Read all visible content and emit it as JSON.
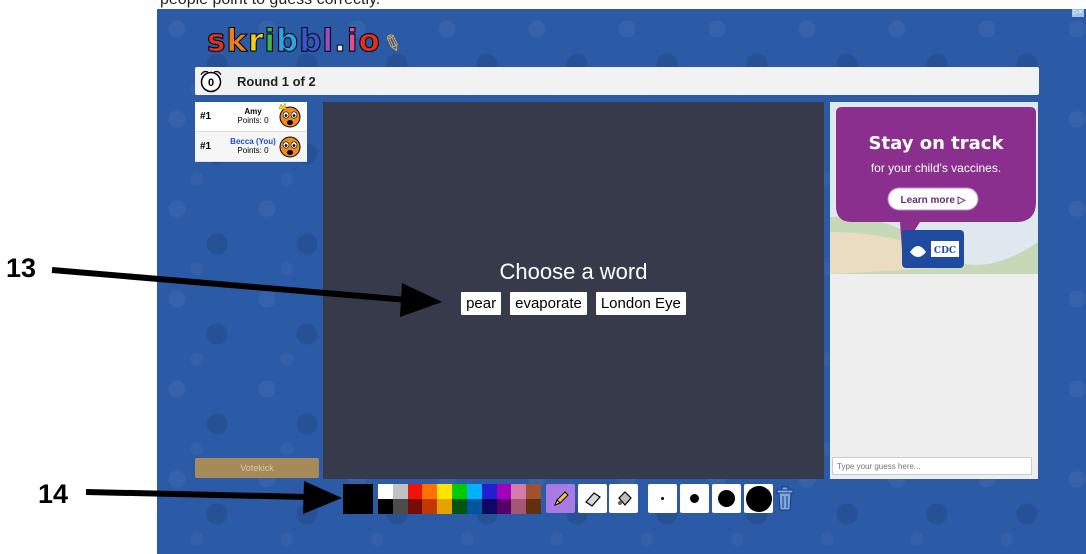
{
  "page_top_text": "people point to guess correctly.",
  "ad_tag": "▷×",
  "logo": {
    "letters": [
      {
        "ch": "s",
        "color": "#e0301e"
      },
      {
        "ch": "k",
        "color": "#f07c1a"
      },
      {
        "ch": "r",
        "color": "#f5d01a"
      },
      {
        "ch": "i",
        "color": "#42b24a"
      },
      {
        "ch": "b",
        "color": "#2fa3e0"
      },
      {
        "ch": "b",
        "color": "#3b54c8"
      },
      {
        "ch": "l",
        "color": "#9a4ec4"
      },
      {
        "ch": ".",
        "color": "#e8e8e8"
      },
      {
        "ch": "i",
        "color": "#e64c8c"
      },
      {
        "ch": "o",
        "color": "#e0301e"
      }
    ]
  },
  "round": {
    "clock_value": "0",
    "label": "Round 1 of 2"
  },
  "players": [
    {
      "rank": "#1",
      "name": "Amy",
      "points": "Points: 0",
      "is_you": false,
      "owner": true
    },
    {
      "rank": "#1",
      "name": "Becca (You)",
      "points": "Points: 0",
      "is_you": true,
      "owner": false
    }
  ],
  "canvas": {
    "prompt": "Choose a word",
    "words": [
      "pear",
      "evaporate",
      "London Eye"
    ]
  },
  "ad": {
    "headline": "Stay on track",
    "subline": "for your child's vaccines.",
    "cta": "Learn more ▷",
    "logo_text": "CDC"
  },
  "chat": {
    "placeholder": "Type your guess here..."
  },
  "votekick_label": "Votekick",
  "palette": {
    "current": "#000000",
    "top_row": [
      "#ffffff",
      "#c1c1c1",
      "#ef130b",
      "#ff7100",
      "#ffe400",
      "#00cc00",
      "#00b2ff",
      "#231fd3",
      "#a300ba",
      "#d37caa",
      "#a0522d"
    ],
    "bottom_row": [
      "#000000",
      "#4c4c4c",
      "#740b07",
      "#c23800",
      "#e8a200",
      "#005510",
      "#00569e",
      "#0e0865",
      "#550069",
      "#a75574",
      "#63300d"
    ]
  },
  "tools": [
    {
      "name": "pencil-icon",
      "active": true
    },
    {
      "name": "eraser-icon",
      "active": false
    },
    {
      "name": "fill-bucket-icon",
      "active": false
    }
  ],
  "annotations": [
    {
      "label": "13"
    },
    {
      "label": "14"
    }
  ]
}
